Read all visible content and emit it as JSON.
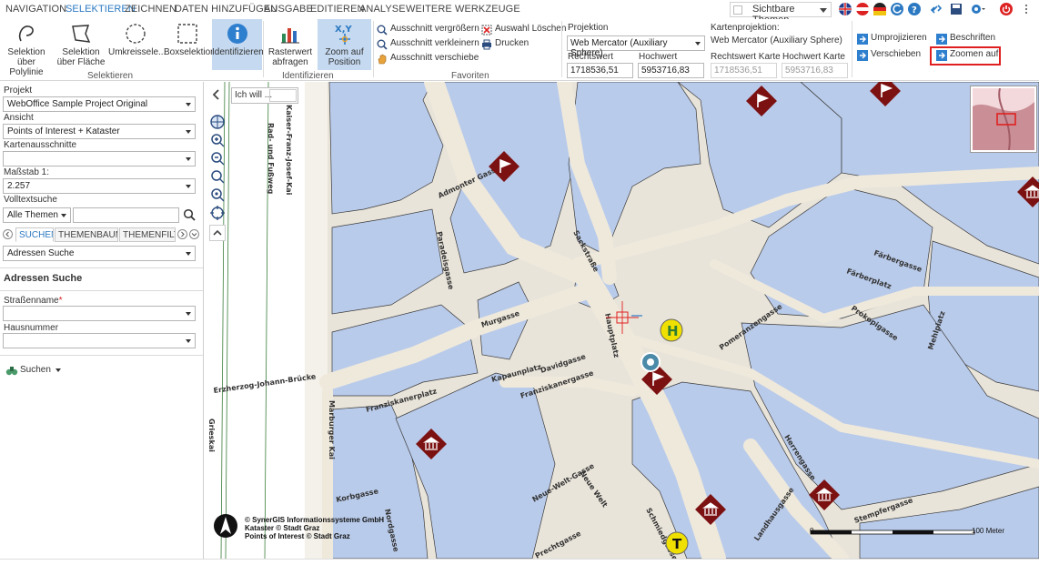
{
  "menu": {
    "items": [
      "NAVIGATION",
      "SELEKTIEREN",
      "ZEICHNEN",
      "DATEN HINZUFÜGEN",
      "AUSGABE",
      "EDITIEREN",
      "ANALYSE",
      "WEITERE WERKZEUGE"
    ],
    "active_index": 1,
    "theme_select_label": "Sichtbare Themen"
  },
  "ribbon": {
    "selection_buttons": [
      {
        "label": "Selektion\nüber Polylinie",
        "icon": "polyline-select-icon"
      },
      {
        "label": "Selektion\nüber Fläche",
        "icon": "polygon-select-icon"
      },
      {
        "label": "Umkreissele...",
        "icon": "circle-select-icon"
      },
      {
        "label": "Boxselektion",
        "icon": "box-select-icon"
      },
      {
        "label": "Identifizieren",
        "icon": "info-icon"
      }
    ],
    "group_selektieren": "Selektieren",
    "raster_label": "Rasterwert\nabfragen",
    "zoompos_label": "Zoom auf\nPosition",
    "group_identifizieren": "Identifizieren",
    "fav_items": [
      "Ausschnitt vergrößern",
      "Ausschnitt verkleinern",
      "Ausschnitt verschiebe"
    ],
    "fav_right": [
      "Auswahl Löschen",
      "Drucken"
    ],
    "group_favoriten": "Favoriten",
    "projektion_label": "Projektion",
    "projektion_value": "Web Mercator (Auxiliary Sphere)",
    "rechtswert_label": "Rechtswert",
    "hochwert_label": "Hochwert",
    "rechtswert_value": "1718536,51",
    "hochwert_value": "5953716,83",
    "kartenprojektion_label": "Kartenprojektion:",
    "kartenprojektion_value": "Web Mercator (Auxiliary Sphere)",
    "rechtswert_karte_label": "Rechtswert Karte",
    "hochwert_karte_label": "Hochwert Karte",
    "rechtswert_karte_value": "1718536,51",
    "hochwert_karte_value": "5953716,83",
    "umprojizieren": "Umprojizieren",
    "verschieben": "Verschieben",
    "beschriften": "Beschriften",
    "zoomen_auf": "Zoomen auf"
  },
  "panel": {
    "projekt_label": "Projekt",
    "projekt_value": "WebOffice Sample Project Original",
    "ansicht_label": "Ansicht",
    "ansicht_value": "Points of Interest + Kataster",
    "kartenausschnitte_label": "Kartenausschnitte",
    "kartenausschnitte_value": "",
    "massstab_label": "Maßstab 1:",
    "massstab_value": "2.257",
    "volltext_label": "Volltextsuche",
    "volltext_select": "Alle Themen",
    "tabs": [
      "SUCHEN",
      "THEMENBAUM",
      "THEMENFILTER"
    ],
    "search_type": "Adressen Suche",
    "section_title": "Adressen Suche",
    "strasse_label": "Straßenname",
    "required_mark": "*",
    "hausnummer_label": "Hausnummer",
    "suchen_button": "Suchen"
  },
  "map": {
    "iwill_label": "Ich will ...",
    "copyright": "© SynerGIS Informationssysteme GmbH\nKataster © Stadt Graz\nPoints of Interest © Stadt Graz",
    "scale_left": "0",
    "scale_right": "100 Meter",
    "streets": [
      "Rad- und Fußweg",
      "Kaiser-Franz-Josef-Kai",
      "Admonter Gasse",
      "Sackstraße",
      "Paradeisgasse",
      "Murgasse",
      "Hauptplatz",
      "Kapaunplatz",
      "Davidgasse",
      "Franziskanergasse",
      "Franziskanerplatz",
      "Erzherzog-Johann-Brücke",
      "Marburger Kai",
      "Grieskai",
      "Neue-Welt-Gasse",
      "Neue Welt",
      "Herrengasse",
      "Landhausgasse",
      "Stempfergasse",
      "Prokopigasse",
      "Färbergasse",
      "Färberplatz",
      "Mehlplatz",
      "Pomeranzengasse",
      "Korbgasse",
      "Nordgasse",
      "Schmiedgasse",
      "Prechtgasse"
    ],
    "poi_letters": [
      "H",
      "T"
    ]
  },
  "colors": {
    "accent": "#2b79c2",
    "building": "#b9cbea",
    "building_stroke": "#3b3b3b",
    "street": "#efe9dc",
    "poi": "#7c1112",
    "highlight": "#e02020",
    "selected_ribbon": "#c5d9f0"
  }
}
